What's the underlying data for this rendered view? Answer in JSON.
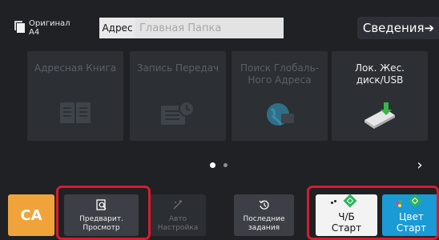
{
  "header": {
    "original_label": "Оригинал",
    "paper_size": "A4",
    "address_label": "Адрес",
    "address_placeholder": "Главная Папка",
    "details_label": "Сведения➔"
  },
  "tiles": [
    {
      "label": "Адресная Книга",
      "enabled": false,
      "icon": "address-book-icon"
    },
    {
      "label": "Запись Передач",
      "enabled": false,
      "icon": "transmission-log-icon"
    },
    {
      "label": "Поиск Глобаль-\nНого Адреса",
      "enabled": false,
      "icon": "global-address-search-icon"
    },
    {
      "label": "Лок. Жес.\nдиск/USB",
      "enabled": true,
      "icon": "usb-drive-icon"
    }
  ],
  "pager": {
    "current": 1,
    "total": 2
  },
  "bottom": {
    "ca_label": "CA",
    "preview": {
      "line1": "Предварит.",
      "line2": "Просмотр"
    },
    "auto": {
      "line1": "Авто",
      "line2": "Настройка"
    },
    "last_jobs": {
      "line1": "Последние",
      "line2": "задания"
    },
    "bw_start": {
      "line1": "Ч/Б",
      "line2": "Старт"
    },
    "color_start": {
      "line1": "Цвет",
      "line2": "Старт"
    }
  },
  "colors": {
    "background": "#1f2124",
    "tile": "#2c2f33",
    "ca": "#f0a33a",
    "color_start": "#1a9bd6",
    "bw_start": "#f3f3f3",
    "start_diamond": "#2db35d",
    "highlight": "#d81c2e"
  }
}
